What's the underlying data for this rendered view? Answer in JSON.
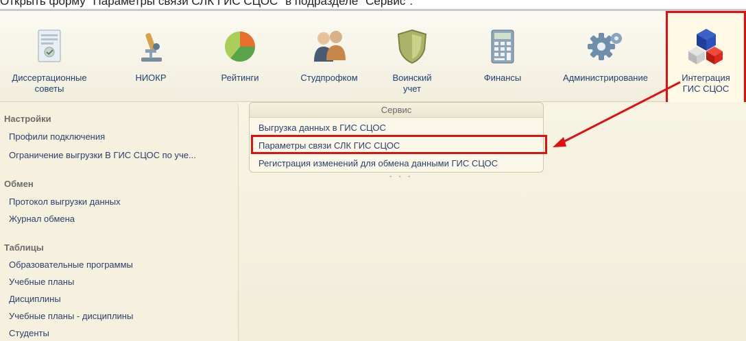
{
  "caption": "Открыть форму \"Параметры связи СЛК ГИС СЦОС\" в подразделе \"Сервис\".",
  "toolbar": {
    "items": [
      {
        "label": "Диссертационные\nсоветы",
        "icon": "document-icon"
      },
      {
        "label": "НИОКР",
        "icon": "microscope-icon"
      },
      {
        "label": "Рейтинги",
        "icon": "pie-chart-icon"
      },
      {
        "label": "Студпрофком",
        "icon": "people-icon"
      },
      {
        "label": "Воинский\nучет",
        "icon": "shield-icon"
      },
      {
        "label": "Финансы",
        "icon": "calculator-icon"
      },
      {
        "label": "Администрирование",
        "icon": "gear-icon"
      },
      {
        "label": "Интеграция\nГИС СЦОС",
        "icon": "cubes-icon"
      }
    ]
  },
  "left": {
    "settings": {
      "title": "Настройки",
      "items": [
        "Профили подключения",
        "Ограничение выгрузки В ГИС СЦОС по уче..."
      ]
    },
    "exchange": {
      "title": "Обмен",
      "items": [
        "Протокол выгрузки данных",
        "Журнал обмена"
      ]
    },
    "tables": {
      "title": "Таблицы",
      "items": [
        "Образовательные программы",
        "Учебные планы",
        "Дисциплины",
        "Учебные планы - дисциплины",
        "Студенты"
      ]
    }
  },
  "service": {
    "title": "Сервис",
    "items": [
      "Выгрузка данных в ГИС СЦОС",
      "Параметры связи СЛК ГИС СЦОС",
      "Регистрация изменений для обмена данными ГИС СЦОС"
    ]
  },
  "colors": {
    "highlight": "#e01010",
    "link": "#2b3f6b"
  }
}
